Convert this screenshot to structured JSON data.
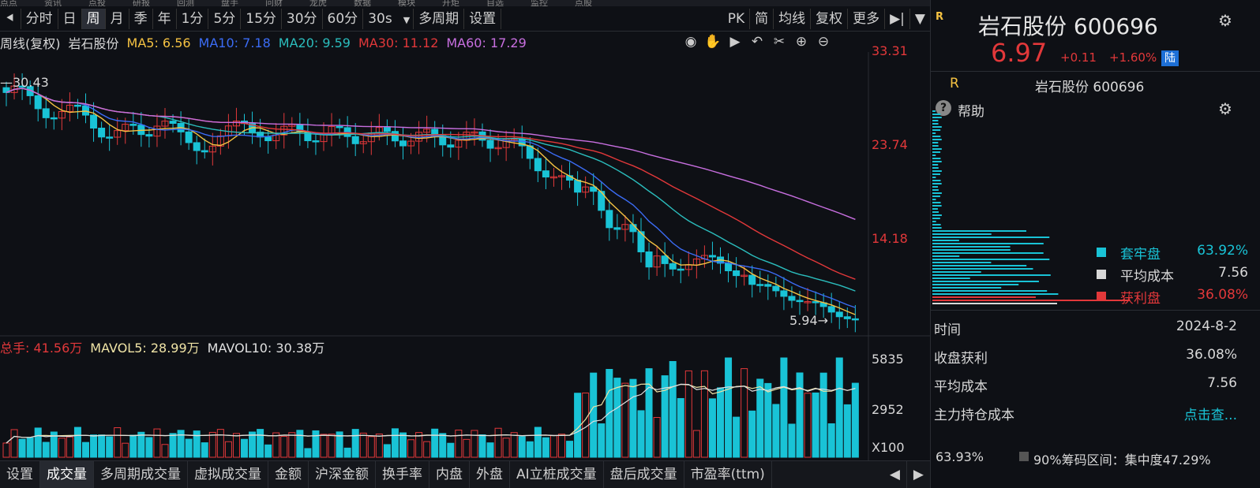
{
  "top_menu": [
    "点点",
    "资讯",
    "点投",
    "研报",
    "回测",
    "盘手",
    "问财",
    "龙虎",
    "数据",
    "模块",
    "开炬",
    "自选",
    "监控",
    "点股"
  ],
  "period_bar": {
    "back_icon": "back-arrow-icon",
    "items": [
      "分时",
      "日",
      "周",
      "月",
      "季",
      "年",
      "1分",
      "5分",
      "15分",
      "30分",
      "60分",
      "30s",
      "多周期",
      "设置"
    ],
    "selected": "周",
    "right_items": [
      "PK",
      "简",
      "均线",
      "复权",
      "更多"
    ]
  },
  "ma_legend": {
    "prefix": "周线(复权)",
    "stock": "岩石股份",
    "items": [
      {
        "label": "MA5: 6.56",
        "color": "#f5c242"
      },
      {
        "label": "MA10: 7.18",
        "color": "#3b6cf5"
      },
      {
        "label": "MA20: 9.59",
        "color": "#2bbdbd"
      },
      {
        "label": "MA30: 11.12",
        "color": "#e2383a"
      },
      {
        "label": "MA60: 17.29",
        "color": "#c86fe0"
      }
    ]
  },
  "price_axis": [
    "33.31",
    "23.74",
    "14.18"
  ],
  "price_markers": {
    "high": "30.43",
    "low": "5.94"
  },
  "vol_legend": [
    {
      "label": "总手: 41.56万",
      "color": "#e2383a"
    },
    {
      "label": "MAVOL5: 28.99万",
      "color": "#f0e4a6"
    },
    {
      "label": "MAVOL10: 30.38万",
      "color": "#e0e0e0"
    }
  ],
  "vol_axis": [
    "5835",
    "2952",
    "X100"
  ],
  "indicator_tabs": [
    "设置",
    "成交量",
    "多周期成交量",
    "虚拟成交量",
    "金额",
    "沪深金额",
    "换手率",
    "内盘",
    "外盘",
    "AI立桩成交量",
    "盘后成交量",
    "市盈率(ttm)"
  ],
  "indicator_selected": "成交量",
  "right_panel": {
    "badge": "R",
    "name": "岩石股份",
    "code": "600696",
    "price": "6.97",
    "change": "+0.11",
    "change_pct": "+1.60%",
    "market_tag": "陆",
    "sub_badge": "R",
    "sub_title": "岩石股份 600696",
    "help_label": "帮助",
    "legend": [
      {
        "label": "套牢盘",
        "value": "63.92%",
        "color": "#19c3d6"
      },
      {
        "label": "平均成本",
        "value": "7.56",
        "color": "#d8d8d8"
      },
      {
        "label": "获利盘",
        "value": "36.08%",
        "color": "#e2383a"
      }
    ],
    "rows": [
      {
        "label": "时间",
        "value": "2024-8-2"
      },
      {
        "label": "收盘获利",
        "value": "36.08%"
      },
      {
        "label": "平均成本",
        "value": "7.56"
      },
      {
        "label": "主力持仓成本",
        "value": "点击查..."
      }
    ],
    "footer_left": "63.93%",
    "footer_right": "90%筹码区间：集中度47.29%"
  },
  "colors": {
    "up": "#e2383a",
    "down": "#19c3d6",
    "bg": "#0e1015",
    "grid": "#2a2d33"
  }
}
